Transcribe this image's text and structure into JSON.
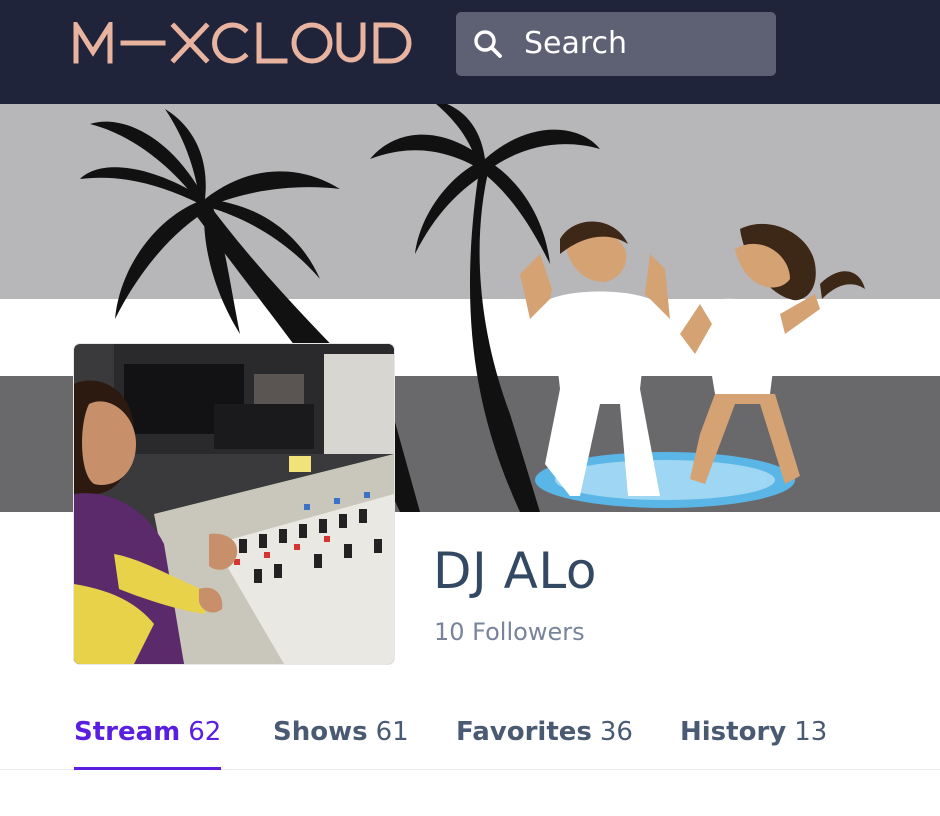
{
  "header": {
    "logo_text": "MIXCLOUD",
    "search_placeholder": "Search"
  },
  "profile": {
    "name": "DJ ALo",
    "followers": "10 Followers"
  },
  "tabs": [
    {
      "label": "Stream",
      "count": "62",
      "active": true
    },
    {
      "label": "Shows",
      "count": "61",
      "active": false
    },
    {
      "label": "Favorites",
      "count": "36",
      "active": false
    },
    {
      "label": "History",
      "count": "13",
      "active": false
    }
  ],
  "colors": {
    "header_bg": "#20243a",
    "logo": "#e8b4a0",
    "search_bg": "#5e6173",
    "active_tab": "#5a1ee0",
    "inactive_tab": "#4a5a72",
    "name_text": "#334963"
  }
}
